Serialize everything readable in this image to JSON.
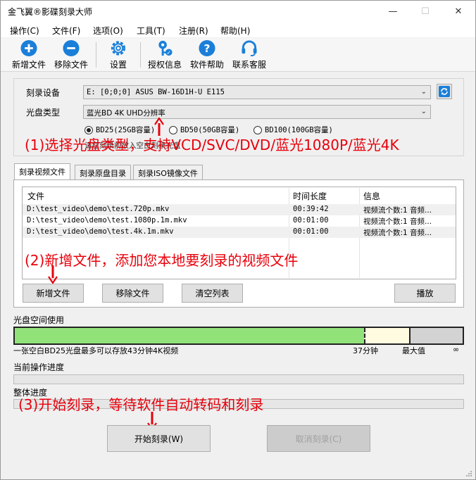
{
  "window": {
    "title": "金飞翼®影碟刻录大师",
    "minimize": "—",
    "maximize": "☐",
    "close": "✕"
  },
  "menu": [
    "操作(C)",
    "文件(F)",
    "选项(O)",
    "工具(T)",
    "注册(R)",
    "帮助(H)"
  ],
  "toolbar": {
    "add_file": "新增文件",
    "remove_file": "移除文件",
    "settings": "设置",
    "license": "授权信息",
    "help": "软件帮助",
    "support": "联系客服"
  },
  "device": {
    "burner_label": "刻录设备",
    "burner_value": "E:  [0;0;0] ASUS BW-16D1H-U E115",
    "disc_type_label": "光盘类型",
    "disc_type_value": "蓝光BD 4K UHD分辨率",
    "capacity_options": [
      "BD25(25GB容量)",
      "BD50(50GB容量)",
      "BD100(100GB容量)"
    ],
    "selected_capacity": 0,
    "hint": "请在刻录前放入空白刻录光盘"
  },
  "annotations": {
    "step1": "(1)选择光盘类型，支持VCD/SVC/DVD/蓝光1080P/蓝光4K",
    "step2": "(2)新增文件，添加您本地要刻录的视频文件",
    "step3": "(3)开始刻录，等待软件自动转码和刻录"
  },
  "tabs": [
    "刻录视频文件",
    "刻录原盘目录",
    "刻录ISO镜像文件"
  ],
  "file_list": {
    "columns": [
      "文件",
      "时间长度",
      "信息"
    ],
    "rows": [
      {
        "file": "D:\\test_video\\demo\\test.720p.mkv",
        "duration": "00:39:42",
        "info": "视频流个数:1 音频..."
      },
      {
        "file": "D:\\test_video\\demo\\test.1080p.1m.mkv",
        "duration": "00:01:00",
        "info": "视频流个数:1 音频..."
      },
      {
        "file": "D:\\test_video\\demo\\test.4k.1m.mkv",
        "duration": "00:01:00",
        "info": "视频流个数:1 音频..."
      }
    ]
  },
  "list_buttons": {
    "add": "新增文件",
    "remove": "移除文件",
    "clear": "清空列表",
    "play": "播放"
  },
  "disc_usage": {
    "label": "光盘空间使用",
    "note": "一张空白BD25光盘最多可以存放43分钟4K视频",
    "used_label": "37分钟",
    "max_label": "最大值",
    "inf_label": "∞",
    "used_fraction": 0.78,
    "max_fraction": 0.88
  },
  "progress": {
    "current_label": "当前操作进度",
    "current_value": 0,
    "overall_label": "整体进度",
    "overall_value": 0
  },
  "actions": {
    "start": "开始刻录(W)",
    "cancel": "取消刻录(C)"
  },
  "colors": {
    "accent_blue": "#1b7fd9",
    "annotation_red": "#e8000b",
    "usage_green": "#92e27a"
  }
}
